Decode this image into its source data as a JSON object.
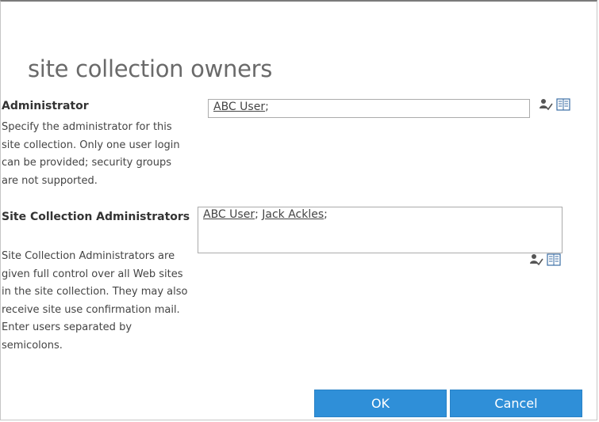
{
  "dialog": {
    "title": "site collection owners"
  },
  "administrator": {
    "heading": "Administrator",
    "description": "Specify the administrator for this site collection. Only one user login can be provided; security groups are not supported.",
    "users": [
      "ABC User"
    ]
  },
  "site_collection_admins": {
    "heading": "Site Collection Administrators",
    "description": "Site Collection Administrators are given full control over all Web sites in the site collection. They may also receive site use confirmation mail. Enter users separated by semicolons.",
    "users": [
      "ABC User",
      "Jack Ackles"
    ]
  },
  "buttons": {
    "ok": "OK",
    "cancel": "Cancel"
  },
  "icons": {
    "check_names": "check-names-icon",
    "browse": "address-book-icon"
  },
  "colors": {
    "button_bg": "#2f8fd8"
  }
}
